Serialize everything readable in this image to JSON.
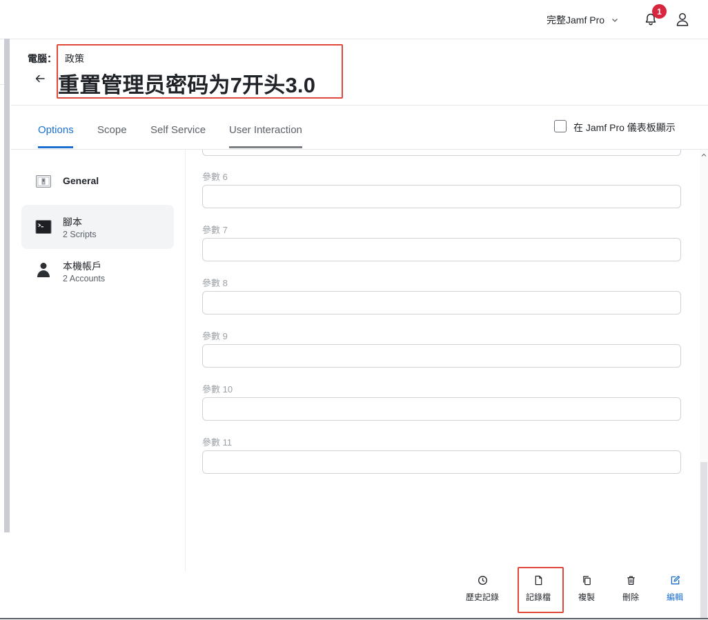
{
  "header": {
    "environment": "完整Jamf Pro",
    "notification_count": "1"
  },
  "breadcrumb": {
    "label": "電腦：",
    "value": "政策"
  },
  "page": {
    "title": "重置管理员密码为7开头3.0"
  },
  "tabs": [
    {
      "label": "Options",
      "active": true
    },
    {
      "label": "Scope"
    },
    {
      "label": "Self Service"
    },
    {
      "label": "User Interaction"
    }
  ],
  "dashboard_toggle": {
    "label": "在 Jamf Pro 儀表板顯示",
    "checked": false
  },
  "sidebar": {
    "items": [
      {
        "title": "General",
        "subtitle": "",
        "icon": "switch-icon"
      },
      {
        "title": "腳本",
        "subtitle": "2 Scripts",
        "icon": "terminal-icon",
        "selected": true
      },
      {
        "title": "本機帳戶",
        "subtitle": "2 Accounts",
        "icon": "person-silhouette-icon"
      }
    ]
  },
  "parameters": [
    {
      "label": "參數 6",
      "value": ""
    },
    {
      "label": "參數 7",
      "value": ""
    },
    {
      "label": "參數 8",
      "value": ""
    },
    {
      "label": "參數 9",
      "value": ""
    },
    {
      "label": "參數 10",
      "value": ""
    },
    {
      "label": "參數 11",
      "value": ""
    }
  ],
  "actions": {
    "history": "歷史記錄",
    "logs": "記錄檔",
    "clone": "複製",
    "delete": "刪除",
    "edit": "編輯"
  },
  "colors": {
    "accent": "#1a6fd1",
    "highlight": "#e0463a",
    "badge": "#d7263d"
  }
}
